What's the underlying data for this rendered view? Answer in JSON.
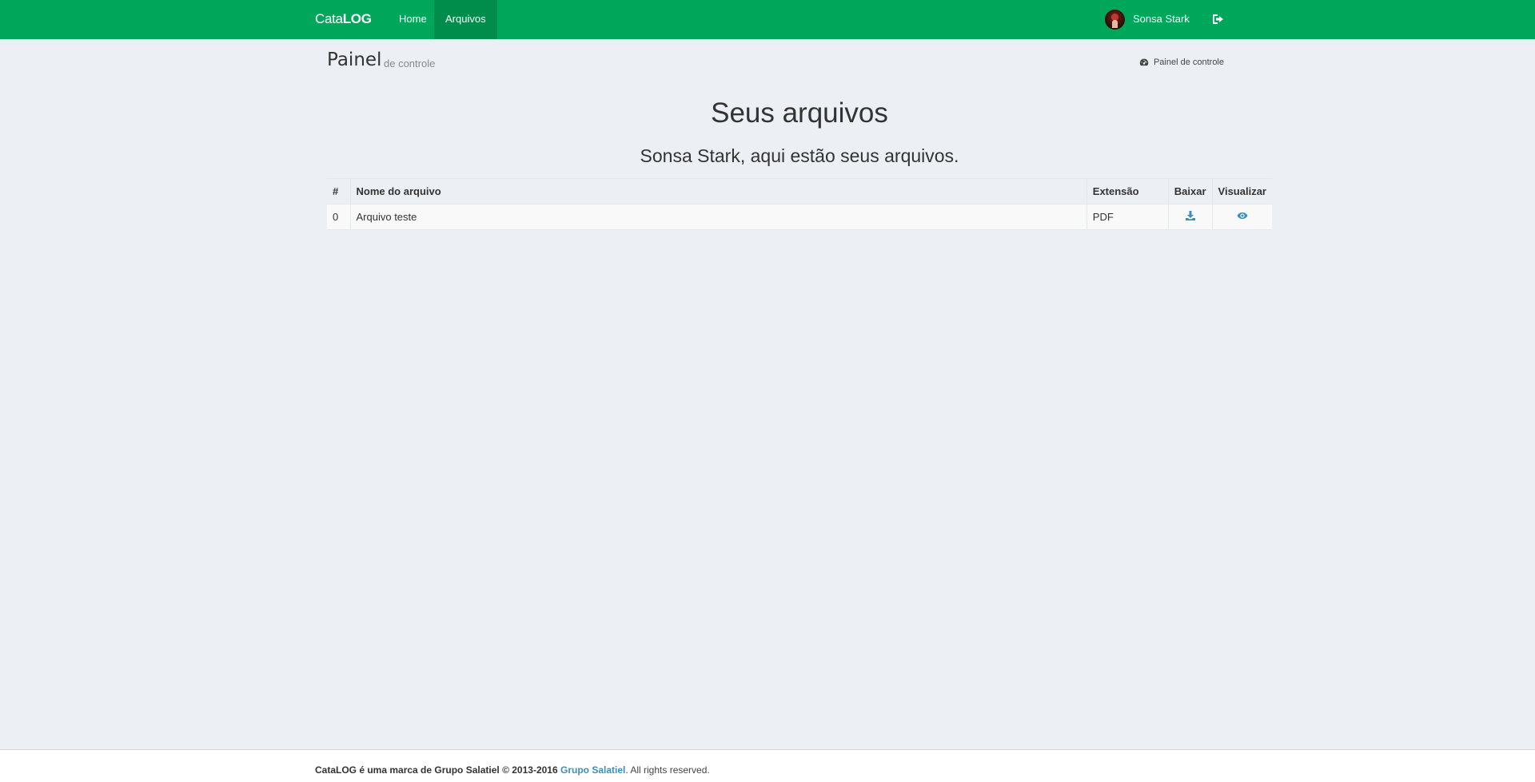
{
  "header": {
    "brand_light": "Cata",
    "brand_bold": "LOG",
    "nav": {
      "home": "Home",
      "files": "Arquivos"
    },
    "user_name": "Sonsa Stark",
    "signout_icon": "sign-out-icon",
    "accent_color": "#00a65a",
    "active_nav_color": "#008d4c"
  },
  "content_header": {
    "title": "Painel",
    "subtitle": "de controle",
    "breadcrumb": "Painel de controle",
    "breadcrumb_icon": "dashboard-icon"
  },
  "main": {
    "title": "Seus arquivos",
    "subtitle": "Sonsa Stark, aqui estão seus arquivos."
  },
  "table": {
    "headers": {
      "index": "#",
      "name": "Nome do arquivo",
      "ext": "Extensão",
      "download": "Baixar",
      "view": "Visualizar"
    },
    "rows": [
      {
        "index": "0",
        "name": "Arquivo teste",
        "ext": "PDF",
        "download_icon": "download-icon",
        "view_icon": "eye-icon"
      }
    ]
  },
  "footer": {
    "text_bold": "CataLOG é uma marca de Grupo Salatiel © 2013-2016",
    "link": "Grupo Salatiel",
    "rights": ". All rights reserved.",
    "link_color": "#3c8dbc"
  }
}
